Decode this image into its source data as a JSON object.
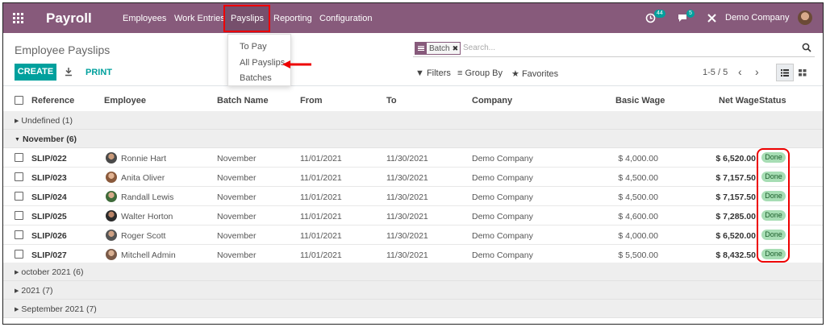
{
  "navbar": {
    "app_title": "Payroll",
    "menu": [
      "Employees",
      "Work Entries",
      "Payslips",
      "Reporting",
      "Configuration"
    ],
    "activities_count": "44",
    "messages_count": "5",
    "company": "Demo Company",
    "color": "#875a7b"
  },
  "dropdown": {
    "items": [
      "To Pay",
      "All Payslips",
      "Batches"
    ]
  },
  "control_panel": {
    "title": "Employee Payslips",
    "create_label": "CREATE",
    "print_label": "PRINT",
    "search_facet": "Batch",
    "search_placeholder": "Search...",
    "filters_label": "Filters",
    "group_by_label": "Group By",
    "favorites_label": "Favorites",
    "pager": "1-5 / 5",
    "accent_color": "#00a09d"
  },
  "table": {
    "columns": [
      "Reference",
      "Employee",
      "Batch Name",
      "From",
      "To",
      "Company",
      "Basic Wage",
      "Net Wage",
      "Status"
    ],
    "groups": [
      {
        "label": "Undefined (1)"
      },
      {
        "label": "November (6)"
      },
      {
        "label": "october 2021 (6)"
      },
      {
        "label": "2021 (7)"
      },
      {
        "label": "September 2021 (7)"
      }
    ],
    "rows": [
      {
        "ref": "SLIP/022",
        "employee": "Ronnie Hart",
        "batch": "November",
        "from": "11/01/2021",
        "to": "11/30/2021",
        "company": "Demo Company",
        "basic": "$ 4,000.00",
        "net": "$ 6,520.00",
        "status": "Done"
      },
      {
        "ref": "SLIP/023",
        "employee": "Anita Oliver",
        "batch": "November",
        "from": "11/01/2021",
        "to": "11/30/2021",
        "company": "Demo Company",
        "basic": "$ 4,500.00",
        "net": "$ 7,157.50",
        "status": "Done"
      },
      {
        "ref": "SLIP/024",
        "employee": "Randall Lewis",
        "batch": "November",
        "from": "11/01/2021",
        "to": "11/30/2021",
        "company": "Demo Company",
        "basic": "$ 4,500.00",
        "net": "$ 7,157.50",
        "status": "Done"
      },
      {
        "ref": "SLIP/025",
        "employee": "Walter Horton",
        "batch": "November",
        "from": "11/01/2021",
        "to": "11/30/2021",
        "company": "Demo Company",
        "basic": "$ 4,600.00",
        "net": "$ 7,285.00",
        "status": "Done"
      },
      {
        "ref": "SLIP/026",
        "employee": "Roger Scott",
        "batch": "November",
        "from": "11/01/2021",
        "to": "11/30/2021",
        "company": "Demo Company",
        "basic": "$ 4,000.00",
        "net": "$ 6,520.00",
        "status": "Done"
      },
      {
        "ref": "SLIP/027",
        "employee": "Mitchell Admin",
        "batch": "November",
        "from": "11/01/2021",
        "to": "11/30/2021",
        "company": "Demo Company",
        "basic": "$ 5,500.00",
        "net": "$ 8,432.50",
        "status": "Done"
      }
    ]
  }
}
